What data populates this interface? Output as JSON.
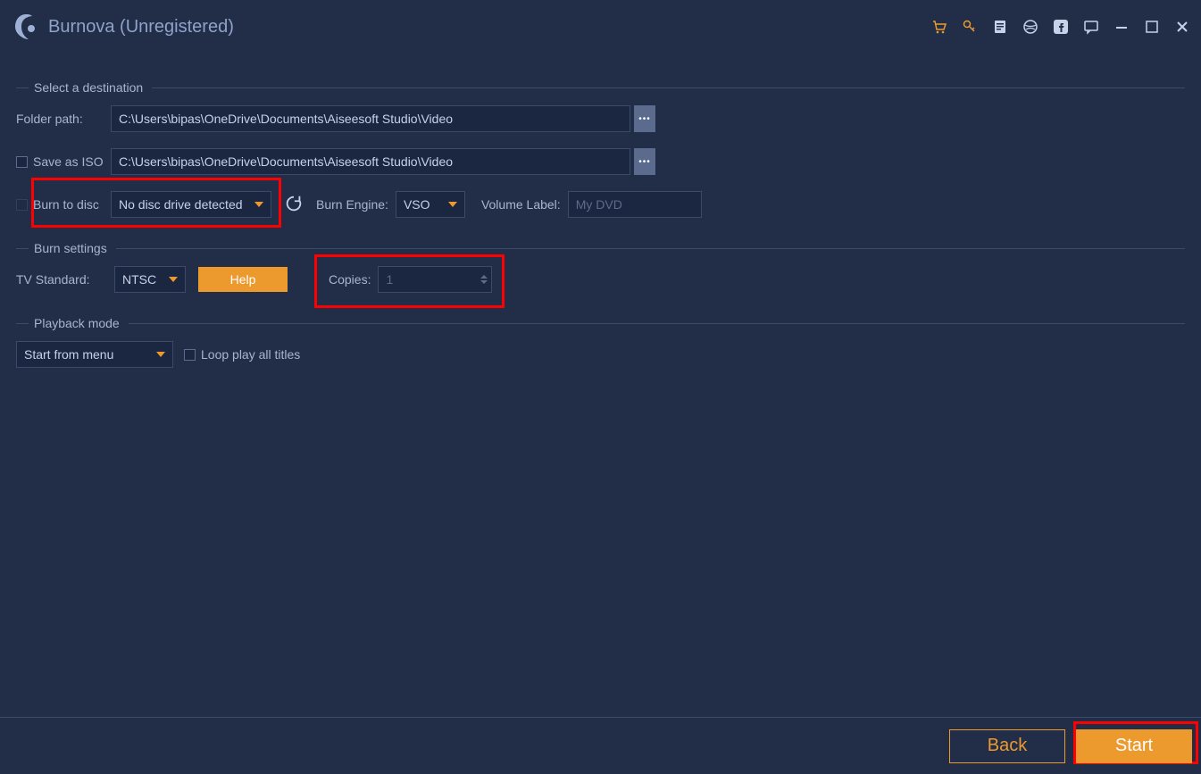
{
  "app": {
    "title": "Burnova (Unregistered)"
  },
  "sections": {
    "destination": {
      "title": "Select a destination",
      "folder_label": "Folder path:",
      "folder_value": "C:\\Users\\bipas\\OneDrive\\Documents\\Aiseesoft Studio\\Video",
      "iso_label": "Save as ISO",
      "iso_value": "C:\\Users\\bipas\\OneDrive\\Documents\\Aiseesoft Studio\\Video",
      "disc_label": "Burn to disc",
      "disc_placeholder": "No disc drive detected",
      "engine_label": "Burn Engine:",
      "engine_value": "VSO",
      "volume_label": "Volume Label:",
      "volume_placeholder": "My DVD"
    },
    "burn": {
      "title": "Burn settings",
      "tv_label": "TV Standard:",
      "tv_value": "NTSC",
      "help_label": "Help",
      "copies_label": "Copies:",
      "copies_value": "1"
    },
    "playback": {
      "title": "Playback mode",
      "mode_value": "Start from menu",
      "loop_label": "Loop play all titles"
    }
  },
  "footer": {
    "back": "Back",
    "start": "Start"
  }
}
